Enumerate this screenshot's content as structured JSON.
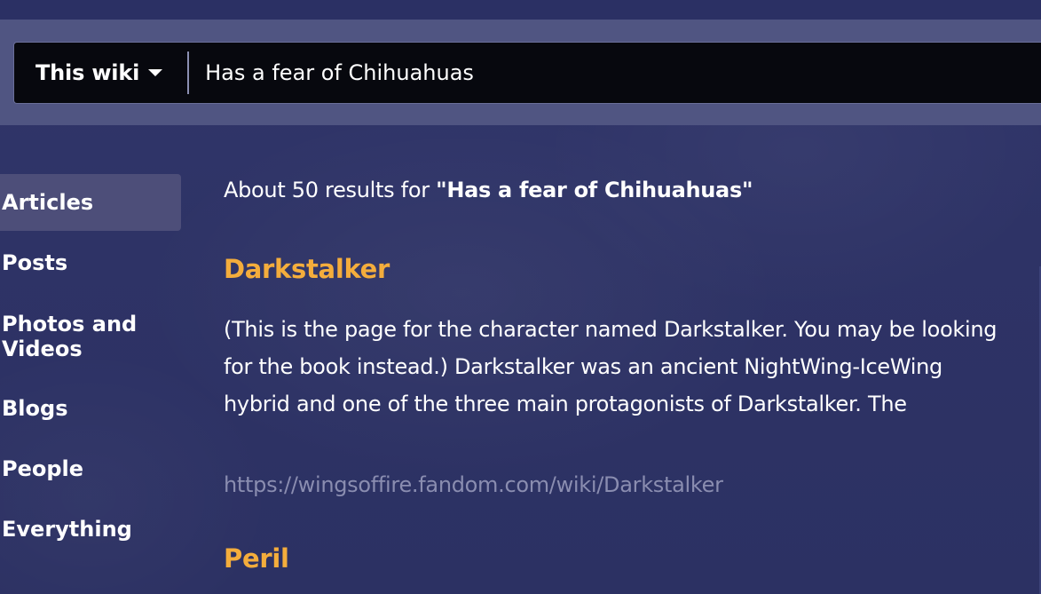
{
  "search": {
    "scope_label": "This wiki",
    "query_value": "Has a fear of Chihuahuas"
  },
  "sidebar": {
    "items": [
      {
        "label": "Articles",
        "active": true
      },
      {
        "label": "Posts"
      },
      {
        "label": "Photos and Videos"
      },
      {
        "label": "Blogs"
      },
      {
        "label": "People"
      },
      {
        "label": "Everything"
      }
    ]
  },
  "results": {
    "summary_prefix": "About 50 results for ",
    "summary_query": "\"Has a fear of Chihuahuas\"",
    "items": [
      {
        "title": "Darkstalker",
        "snippet": "(This is the page for the character named Darkstalker. You may be looking for the book instead.) Darkstalker was an ancient NightWing-IceWing hybrid and one of the three main protagonists of Darkstalker. The",
        "url": "https://wingsoffire.fandom.com/wiki/Darkstalker"
      },
      {
        "title": "Peril"
      }
    ]
  },
  "colors": {
    "background": "#2e3366",
    "search_band": "#505582",
    "search_bar": "#07080e",
    "result_title": "#f4ad3c",
    "url_text": "#8a8db0",
    "active_nav": "#4d4e79"
  },
  "icons": {
    "scope_dropdown": "caret-down-icon"
  }
}
